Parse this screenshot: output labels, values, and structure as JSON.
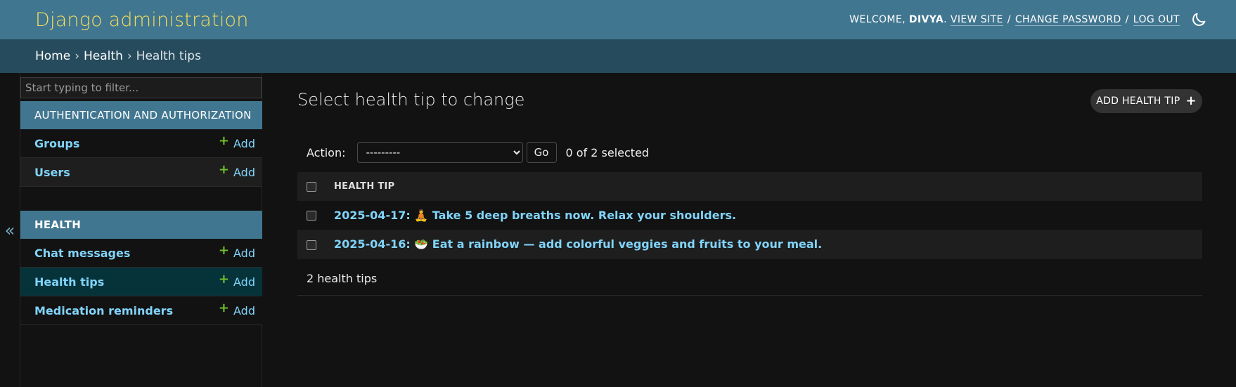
{
  "header": {
    "brand": "Django administration",
    "welcome": "Welcome,",
    "username": "Divya",
    "view_site": "View site",
    "change_password": "Change password",
    "log_out": "Log out",
    "sep1": "/",
    "sep2": "/",
    "period": ".",
    "theme_icon": "moon-icon"
  },
  "breadcrumbs": {
    "home": "Home",
    "app": "Health",
    "current": "Health tips",
    "separator": "›"
  },
  "sidebar": {
    "collapse_label": "«",
    "filter_placeholder": "Start typing to filter...",
    "modules": [
      {
        "caption": "Authentication and Authorization",
        "models": [
          {
            "name": "Groups",
            "add": "Add"
          },
          {
            "name": "Users",
            "add": "Add"
          }
        ]
      },
      {
        "caption": "Health",
        "models": [
          {
            "name": "Chat messages",
            "add": "Add"
          },
          {
            "name": "Health tips",
            "add": "Add"
          },
          {
            "name": "Medication reminders",
            "add": "Add"
          }
        ]
      }
    ]
  },
  "main": {
    "title": "Select health tip to change",
    "add_button": "Add health tip",
    "add_plus": "+",
    "action_label": "Action:",
    "action_selected": "---------",
    "go_label": "Go",
    "counter": "0 of 2 selected",
    "column_header": "Health tip",
    "rows": [
      {
        "text": "2025-04-17: 🧘 Take 5 deep breaths now. Relax your shoulders."
      },
      {
        "text": "2025-04-16: 🥗 Eat a rainbow — add colorful veggies and fruits to your meal."
      }
    ],
    "paginator": "2 health tips"
  },
  "colors": {
    "header_bg": "#417690",
    "brand": "#f5dd5d",
    "breadcrumbs_bg": "#264b5d",
    "link": "#81d4fa",
    "add_plus": "#70bf2b",
    "current_model_bg": "#06333a",
    "page_bg": "#121212"
  }
}
